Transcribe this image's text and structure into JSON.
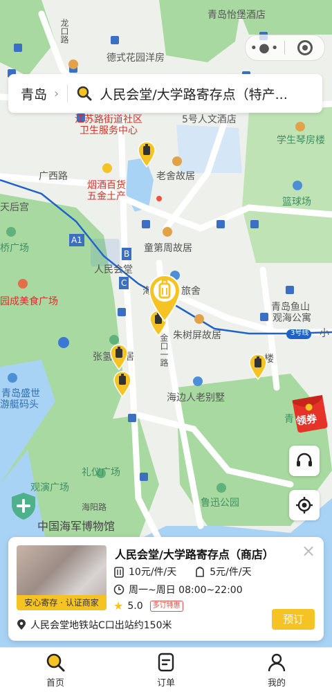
{
  "search": {
    "city": "青岛",
    "query": "人民会堂/大学路寄存点（特产..."
  },
  "map_labels": {
    "hotel": "青岛怡堡酒店",
    "longkou_rd": "龙口路",
    "german_villa": "德式花园洋房",
    "jiangsu_clinic_1": "江苏路街道社区",
    "jiangsu_clinic_2": "卫生服务中心",
    "hotel5": "5号人文酒店",
    "qinfang": "学生琴房楼",
    "guangxi_rd": "广西路",
    "laoshe": "老舍故居",
    "tobacco_1": "烟酒百货",
    "tobacco_2": "五金土产",
    "tianhou": "天后宫",
    "court": "篮球场",
    "bridge_sq": "桥广场",
    "tongdizhou": "童第周故居",
    "renmin_hall": "人民会堂",
    "hai_hotel": "海",
    "travel_house": "旅舍",
    "yushan_1": "青岛鱼山",
    "yushan_2": "观海公寓",
    "food_sq": "园成美食广场",
    "zhushuping": "朱树屏故居",
    "jinkou_rd": "金口一路",
    "line3": "3号线",
    "xiao": "小",
    "zhang": "张氢",
    "ju": "居",
    "lou": "楼",
    "shengshi_1": "青岛盛世",
    "shengshi_2": "游艇码头",
    "haibian": "海边人老别墅",
    "qing": "青",
    "liyi_sq": "礼仪广场",
    "guanyan_sq": "观演广场",
    "haiyang_rd": "海阳路",
    "luxun_park": "鲁迅公园",
    "navy_museum": "中国海军博物馆",
    "exit_a1": "A1",
    "exit_b": "B",
    "exit_c": "C"
  },
  "coupon": {
    "label": "领券"
  },
  "store": {
    "name": "人民会堂/大学路寄存点（商店）",
    "badge": "安心寄存 · 认证商家",
    "price_large": "10元/件/天",
    "price_small": "5元/件/天",
    "hours": "周一~周日 08:00~22:00",
    "rating": "5.0",
    "discount": "多订特惠",
    "location": "人民会堂地铁站C口出站约150米",
    "book_label": "预订"
  },
  "tabs": [
    {
      "label": "首页",
      "icon": "search-icon",
      "active": true
    },
    {
      "label": "订单",
      "icon": "order-icon",
      "active": false
    },
    {
      "label": "我的",
      "icon": "user-icon",
      "active": false
    }
  ],
  "colors": {
    "accent": "#f5c324",
    "map_background": "#eef0ec",
    "park_green": "#a8d9a0",
    "sea_blue": "#a9d3f5",
    "metro_line": "#1f63c9"
  }
}
